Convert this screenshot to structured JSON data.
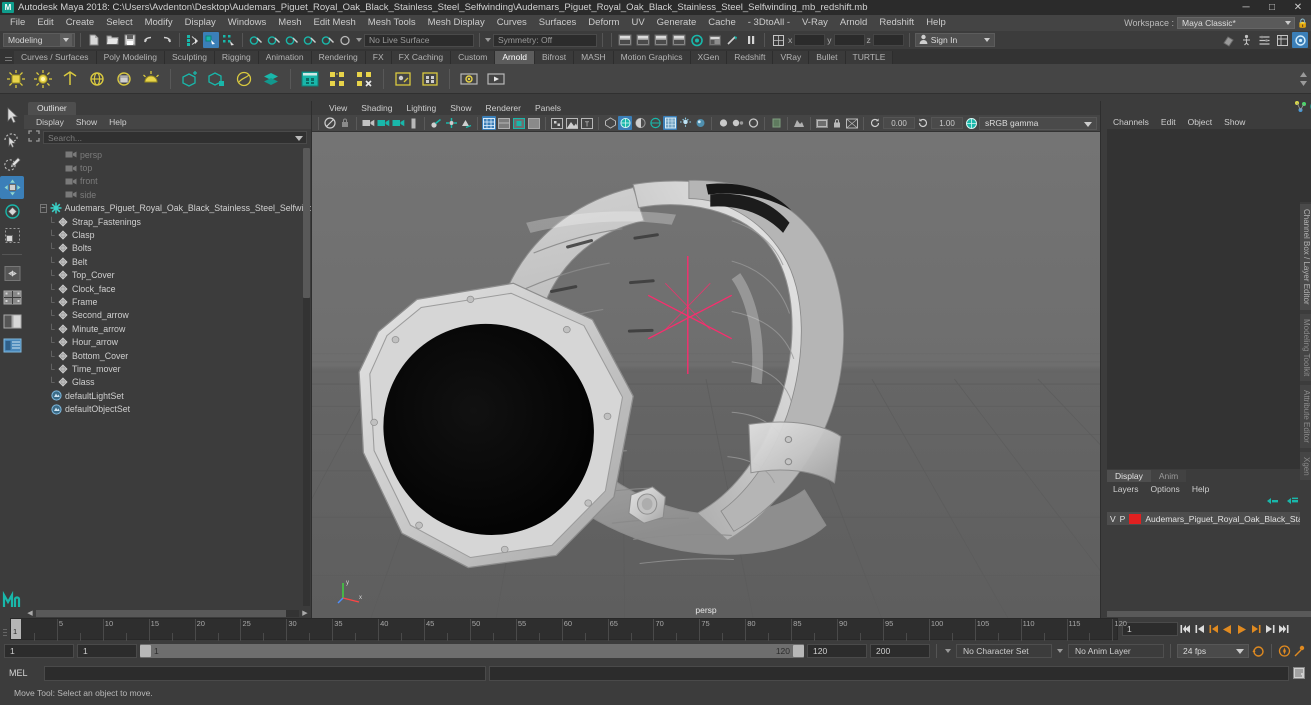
{
  "titlebar": {
    "app_title": "Autodesk Maya 2018: C:\\Users\\Avdenton\\Desktop\\Audemars_Piguet_Royal_Oak_Black_Stainless_Steel_Selfwinding\\Audemars_Piguet_Royal_Oak_Black_Stainless_Steel_Selfwinding_mb_redshift.mb",
    "logo": "M",
    "minimize": "─",
    "maximize": "□",
    "close": "✕"
  },
  "menubar": {
    "items": [
      "File",
      "Edit",
      "Create",
      "Select",
      "Modify",
      "Display",
      "Windows",
      "Mesh",
      "Edit Mesh",
      "Mesh Tools",
      "Mesh Display",
      "Curves",
      "Surfaces",
      "Deform",
      "UV",
      "Generate",
      "Cache",
      "- 3DtoAll -",
      "V-Ray",
      "Arnold",
      "Redshift",
      "Help"
    ],
    "workspace_label": "Workspace :",
    "workspace_value": "Maya Classic*",
    "lock_icon": "lock-icon"
  },
  "statusline": {
    "mode": "Modeling",
    "live_surface": "No Live Surface",
    "symmetry": "Symmetry: Off",
    "coord_labels": [
      "x",
      "y",
      "z"
    ],
    "coord_values": [
      "",
      "",
      ""
    ],
    "signin": "Sign In",
    "icons": [
      "new-scene-icon",
      "open-scene-icon",
      "save-scene-icon",
      "undo-icon",
      "redo-icon",
      "select-by-hierarchy-icon",
      "select-by-object-icon",
      "select-by-component-icon",
      "snap-grid-icon",
      "snap-curve-icon",
      "snap-point-icon",
      "snap-projected-icon",
      "snap-view-icon",
      "snap-pivot-icon",
      "render-current-frame-icon",
      "ipr-render-icon",
      "render-settings-icon",
      "hypershade-icon",
      "render-view-icon",
      "pause-icon"
    ]
  },
  "shelf": {
    "tabs": [
      "Curves / Surfaces",
      "Poly Modeling",
      "Sculpting",
      "Rigging",
      "Animation",
      "Rendering",
      "FX",
      "FX Caching",
      "Custom",
      "Arnold",
      "Bifrost",
      "MASH",
      "Motion Graphics",
      "XGen",
      "Redshift",
      "VRay",
      "Bullet",
      "TURTLE"
    ],
    "active_tab": "Arnold",
    "icons": [
      "arnold-area-light-icon",
      "arnold-skydome-light-icon",
      "arnold-mesh-light-icon",
      "arnold-photometric-light-icon",
      "arnold-physical-sky-icon",
      "arnold-light-portal-icon",
      "arnold-standin-create-icon",
      "arnold-standin-export-icon",
      "arnold-volume-icon",
      "arnold-scene-source-icon",
      "arnold-render-icon",
      "arnold-add-attributes-icon",
      "arnold-remove-attributes-icon",
      "arnold-flush-cache-icon",
      "arnold-bake-icon",
      "arnold-open-render-view-icon",
      "arnold-ipr-start-icon"
    ]
  },
  "toolbox": {
    "items": [
      "select-tool-icon",
      "lasso-select-tool-icon",
      "paint-select-tool-icon",
      "move-tool-icon",
      "rotate-tool-icon",
      "scale-tool-icon",
      "last-tool-icon",
      "single-perspective-layout-icon",
      "four-view-layout-icon",
      "two-pane-layout-icon",
      "outliner-persp-layout-icon"
    ],
    "active": "move-tool-icon",
    "logo": "M"
  },
  "outliner": {
    "tab": "Outliner",
    "menu": [
      "Display",
      "Show",
      "Help"
    ],
    "search_placeholder": "Search...",
    "nodes": [
      {
        "label": "persp",
        "type": "camera",
        "depth": 1,
        "dim": true
      },
      {
        "label": "top",
        "type": "camera",
        "depth": 1,
        "dim": true
      },
      {
        "label": "front",
        "type": "camera",
        "depth": 1,
        "dim": true
      },
      {
        "label": "side",
        "type": "camera",
        "depth": 1,
        "dim": true
      },
      {
        "label": "Audemars_Piguet_Royal_Oak_Black_Stainless_Steel_Selfwinding_",
        "type": "group",
        "depth": 0,
        "dim": false,
        "expanded": true
      },
      {
        "label": "Strap_Fastenings",
        "type": "mesh",
        "depth": 1,
        "dim": false
      },
      {
        "label": "Clasp",
        "type": "mesh",
        "depth": 1,
        "dim": false
      },
      {
        "label": "Bolts",
        "type": "mesh",
        "depth": 1,
        "dim": false
      },
      {
        "label": "Belt",
        "type": "mesh",
        "depth": 1,
        "dim": false
      },
      {
        "label": "Top_Cover",
        "type": "mesh",
        "depth": 1,
        "dim": false
      },
      {
        "label": "Clock_face",
        "type": "mesh",
        "depth": 1,
        "dim": false
      },
      {
        "label": "Frame",
        "type": "mesh",
        "depth": 1,
        "dim": false
      },
      {
        "label": "Second_arrow",
        "type": "mesh",
        "depth": 1,
        "dim": false
      },
      {
        "label": "Minute_arrow",
        "type": "mesh",
        "depth": 1,
        "dim": false
      },
      {
        "label": "Hour_arrow",
        "type": "mesh",
        "depth": 1,
        "dim": false
      },
      {
        "label": "Bottom_Cover",
        "type": "mesh",
        "depth": 1,
        "dim": false
      },
      {
        "label": "Time_mover",
        "type": "mesh",
        "depth": 1,
        "dim": false
      },
      {
        "label": "Glass",
        "type": "mesh",
        "depth": 1,
        "dim": false
      },
      {
        "label": "defaultLightSet",
        "type": "set",
        "depth": 0,
        "dim": false
      },
      {
        "label": "defaultObjectSet",
        "type": "set",
        "depth": 0,
        "dim": false
      }
    ]
  },
  "viewport": {
    "menu": [
      "View",
      "Shading",
      "Lighting",
      "Show",
      "Renderer",
      "Panels"
    ],
    "exposure": "0.00",
    "gamma": "1.00",
    "colorspace": "sRGB gamma",
    "camera_label": "persp",
    "axis_labels": [
      "y",
      "x",
      "z"
    ]
  },
  "channelbox": {
    "menu": [
      "Channels",
      "Edit",
      "Object",
      "Show"
    ],
    "vertical_tabs": [
      "Channel Box / Layer Editor",
      "Modeling Toolkit",
      "Attribute Editor",
      "Xgen"
    ]
  },
  "layereditor": {
    "tabs": [
      "Display",
      "Anim"
    ],
    "active_tab": "Display",
    "menu": [
      "Layers",
      "Options",
      "Help"
    ],
    "col_v": "V",
    "col_p": "P",
    "layers": [
      {
        "name": "Audemars_Piguet_Royal_Oak_Black_Stainless_Steel_Self",
        "color": "#e02020"
      }
    ]
  },
  "timeline": {
    "ticks": [
      5,
      10,
      15,
      20,
      25,
      30,
      35,
      40,
      45,
      50,
      55,
      60,
      65,
      70,
      75,
      80,
      85,
      90,
      95,
      100,
      105,
      110,
      115,
      120
    ],
    "current_frame": "1",
    "current_frame_field": "1",
    "playback_icons": [
      "go-to-start-icon",
      "step-back-keyframe-icon",
      "step-back-frame-icon",
      "play-backwards-icon",
      "play-forwards-icon",
      "step-forward-frame-icon",
      "step-forward-keyframe-icon",
      "go-to-end-icon"
    ]
  },
  "rangeslider": {
    "anim_start": "1",
    "range_start": "1",
    "bar_start": "1",
    "bar_end": "120",
    "range_end": "120",
    "anim_end": "200",
    "character_set": "No Character Set",
    "anim_layer": "No Anim Layer",
    "fps": "24 fps",
    "auto_key_icon": "auto-keyframe-icon",
    "prefs_icon": "animation-preferences-icon",
    "cycle_icon": "playback-loop-icon"
  },
  "commandline": {
    "language": "MEL",
    "input_value": "",
    "output_value": "",
    "script_editor_icon": "script-editor-icon"
  },
  "helpline": {
    "text": "Move Tool: Select an object to move."
  },
  "colors": {
    "accent_blue": "#3b7fb8",
    "accent_teal": "#19b7aa",
    "accent_orange": "#e08a20",
    "layer_red": "#e02020",
    "panel_bg": "#3c3c3c",
    "viewport_bg": "#6a6a6a"
  }
}
